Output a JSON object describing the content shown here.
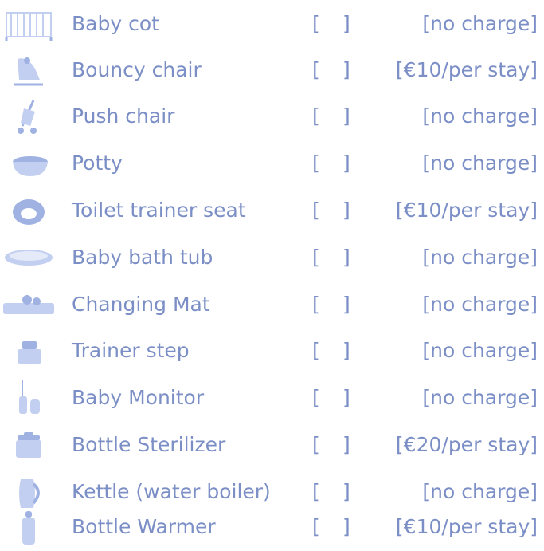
{
  "items": [
    {
      "name": "Baby cot",
      "icon": "baby-cot-icon",
      "charge": "[no charge]"
    },
    {
      "name": "Bouncy chair",
      "icon": "bouncy-chair-icon",
      "charge": "[€10/per stay]"
    },
    {
      "name": "Push chair",
      "icon": "push-chair-icon",
      "charge": "[no charge]"
    },
    {
      "name": "Potty",
      "icon": "potty-icon",
      "charge": "[no charge]"
    },
    {
      "name": "Toilet trainer seat",
      "icon": "toilet-trainer-seat-icon",
      "charge": "[€10/per stay]"
    },
    {
      "name": "Baby bath tub",
      "icon": "baby-bath-tub-icon",
      "charge": "[no charge]"
    },
    {
      "name": "Changing Mat",
      "icon": "changing-mat-icon",
      "charge": "[no charge]"
    },
    {
      "name": "Trainer step",
      "icon": "trainer-step-icon",
      "charge": "[no charge]"
    },
    {
      "name": "Baby Monitor",
      "icon": "baby-monitor-icon",
      "charge": "[no charge]"
    },
    {
      "name": "Bottle Sterilizer",
      "icon": "bottle-sterilizer-icon",
      "charge": "[€20/per stay]"
    },
    {
      "name": "Kettle (water boiler)",
      "icon": "kettle-icon",
      "charge": "[no charge]"
    },
    {
      "name": "Bottle Warmer",
      "icon": "bottle-warmer-icon",
      "charge": "[€10/per stay]"
    }
  ],
  "checkbox": {
    "left": "[",
    "right": "]"
  },
  "colors": {
    "text": "#7b8fc6",
    "icon": "#c3cff0",
    "icon_dark": "#9fb2e2"
  }
}
